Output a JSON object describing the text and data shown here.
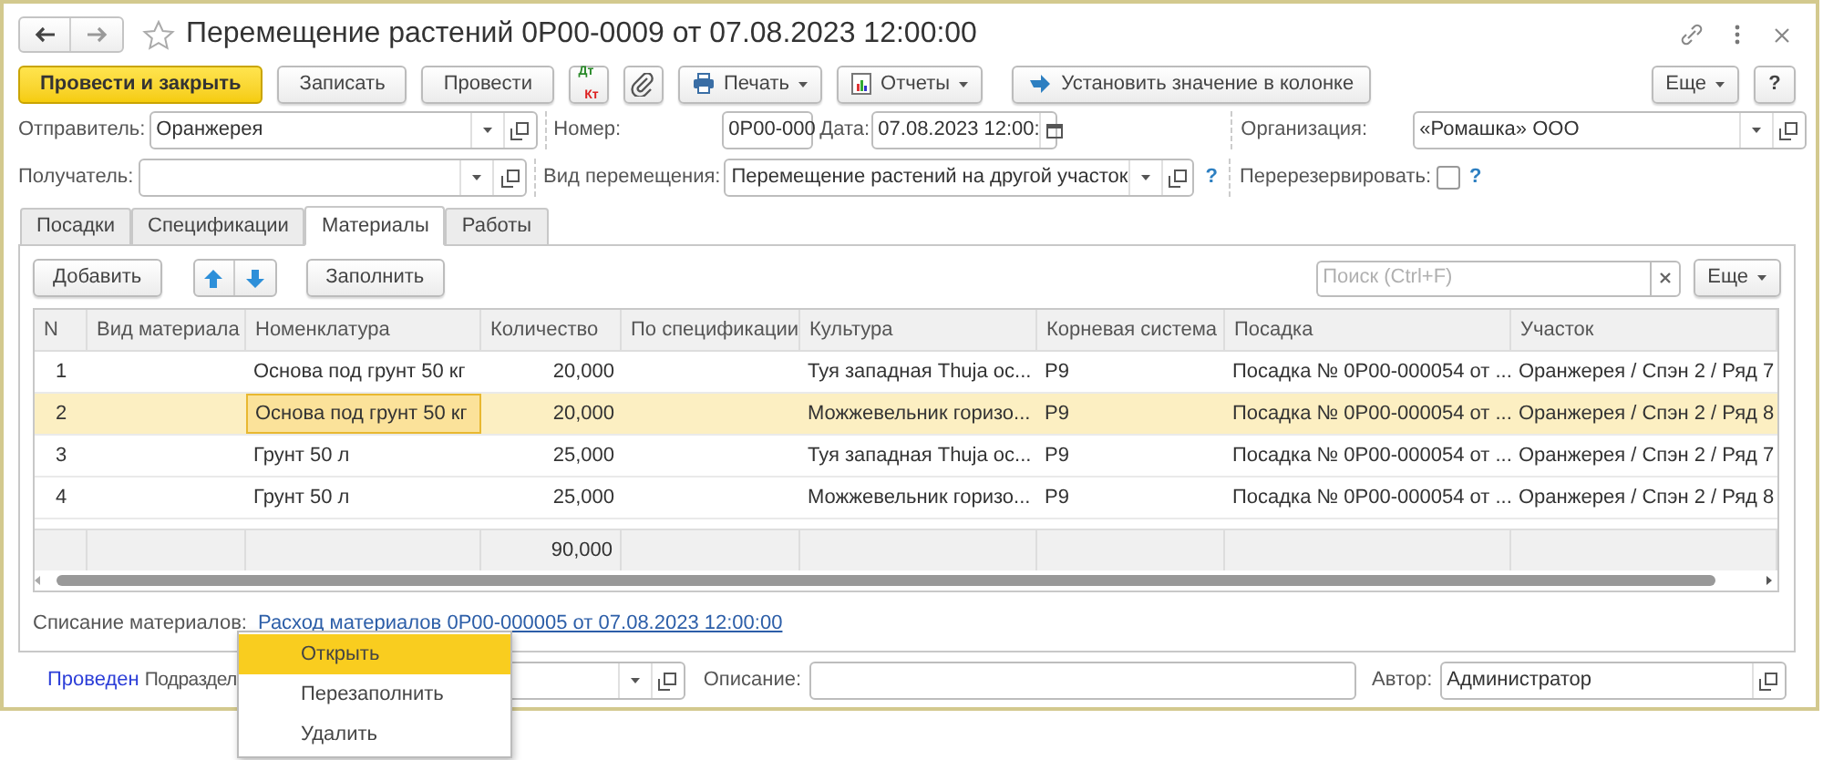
{
  "window": {
    "title": "Перемещение растений 0P00-0009 от 07.08.2023 12:00:00",
    "favorite": false
  },
  "toolbar": {
    "buttons": [
      {
        "kind": "primary",
        "label": "Провести и закрыть"
      },
      {
        "kind": "text",
        "label": "Записать"
      },
      {
        "kind": "text",
        "label": "Провести"
      },
      {
        "kind": "dtkt",
        "label_top": "Дт",
        "label_bottom": "Кт"
      },
      {
        "kind": "attach"
      },
      {
        "kind": "print",
        "label": "Печать"
      },
      {
        "kind": "reports",
        "label": "Отчеты"
      },
      {
        "kind": "set_value",
        "label": "Установить значение в колонке"
      }
    ],
    "more": "Еще",
    "help": "?"
  },
  "form": {
    "sender": {
      "label": "Отправитель:",
      "value": "Оранжерея"
    },
    "receiver": {
      "label": "Получатель:"
    },
    "number": {
      "label": "Номер:",
      "value": "0P00-000"
    },
    "date": {
      "label": "Дата:",
      "value": "07.08.2023 12:00:"
    },
    "movement_type": {
      "label": "Вид перемещения:",
      "value": "Перемещение растений на другой участок",
      "help": "?"
    },
    "organization": {
      "label": "Организация:",
      "value": "«Ромашка» ООО"
    },
    "rereserve": {
      "label": "Перерезервировать:",
      "checked": false,
      "help": "?"
    }
  },
  "tabs": [
    {
      "label": "Посадки",
      "selected": false
    },
    {
      "label": "Спецификации",
      "selected": false
    },
    {
      "label": "Материалы",
      "selected": true
    },
    {
      "label": "Работы",
      "selected": false
    }
  ],
  "table_toolbar": {
    "add": "Добавить",
    "fill": "Заполнить",
    "search_placeholder": "Поиск (Ctrl+F)",
    "more": "Еще"
  },
  "table": {
    "columns": [
      {
        "title": "N",
        "kind": "index",
        "focused": false
      },
      {
        "title": "Вид материала",
        "kind": "text",
        "focused": false
      },
      {
        "title": "Номенклатура",
        "kind": "text",
        "focused": true
      },
      {
        "title": "Количество",
        "kind": "number",
        "focused": false,
        "total": "90,000"
      },
      {
        "title": "По спецификации",
        "kind": "text",
        "focused": false
      },
      {
        "title": "Культура",
        "kind": "text",
        "focused": false
      },
      {
        "title": "Корневая система",
        "kind": "text",
        "focused": false
      },
      {
        "title": "Посадка",
        "kind": "text",
        "focused": false
      },
      {
        "title": "Участок",
        "kind": "text",
        "focused": false
      }
    ],
    "rows": [
      {
        "cells": [
          "1",
          "",
          "Основа под грунт 50 кг",
          "20,000",
          "",
          "Туя западная Thuja ос...",
          "P9",
          "Посадка № 0P00-000054 от ...",
          "Оранжерея / Спэн 2 / Ряд 7"
        ],
        "selected": false
      },
      {
        "cells": [
          "2",
          "",
          "Основа под грунт 50 кг",
          "20,000",
          "",
          "Можжевельник горизо...",
          "P9",
          "Посадка № 0P00-000054 от ...",
          "Оранжерея / Спэн 2 / Ряд 8"
        ],
        "selected": true
      },
      {
        "cells": [
          "3",
          "",
          "Грунт 50 л",
          "25,000",
          "",
          "Туя западная Thuja ос...",
          "P9",
          "Посадка № 0P00-000054 от ...",
          "Оранжерея / Спэн 2 / Ряд 7"
        ],
        "selected": false
      },
      {
        "cells": [
          "4",
          "",
          "Грунт 50 л",
          "25,000",
          "",
          "Можжевельник горизо...",
          "P9",
          "Посадка № 0P00-000054 от ...",
          "Оранжерея / Спэн 2 / Ряд 8"
        ],
        "selected": false
      }
    ]
  },
  "write_off": {
    "label": "Списание материалов:",
    "link": "Расход материалов 0P00-000005 от 07.08.2023 12:00:00"
  },
  "footer": {
    "status": "Проведен",
    "department": {
      "label": "Подраздел"
    },
    "description": {
      "label": "Описание:"
    },
    "author": {
      "label": "Автор:",
      "value": "Администратор"
    }
  },
  "context_menu": [
    {
      "label": "Открыть",
      "selected": true
    },
    {
      "label": "Перезаполнить",
      "selected": false
    },
    {
      "label": "Удалить",
      "selected": false
    }
  ]
}
